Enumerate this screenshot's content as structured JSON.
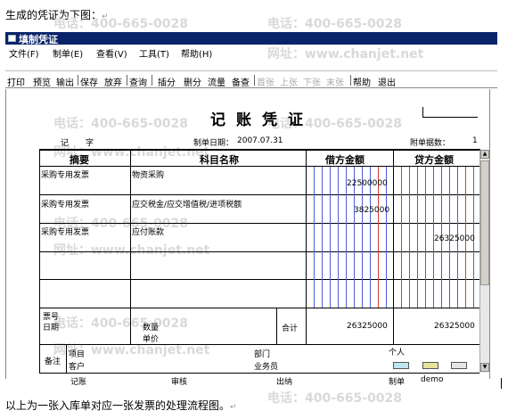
{
  "intro_text": "生成的凭证为下图：",
  "return_mark": "↵",
  "window": {
    "title": "填制凭证"
  },
  "watermark": {
    "phone": "电话：400-665-0028",
    "site": "网址：www.chanjet.net"
  },
  "menu": [
    "文件(F)",
    "制单(E)",
    "查看(V)",
    "工具(T)",
    "帮助(H)"
  ],
  "toolbar": {
    "print": "打印",
    "preview": "预览",
    "export": "输出",
    "save": "保存",
    "discard": "放弃",
    "query": "查询",
    "insert": "插分",
    "delete": "删分",
    "flow": "流量",
    "note": "备查",
    "first": "首张",
    "prev": "上张",
    "next": "下张",
    "last": "末张",
    "help": "帮助",
    "exit": "退出"
  },
  "voucher": {
    "title": "记账凭证",
    "type_label": "记",
    "number_label": "字",
    "date_label": "制单日期：",
    "date": "2007.07.31",
    "attach_label": "附单据数：",
    "attach_count": "1",
    "columns": {
      "summary": "摘要",
      "account": "科目名称",
      "debit": "借方金额",
      "credit": "贷方金额"
    },
    "rows": [
      {
        "summary": "采购专用发票",
        "account": "物资采购",
        "debit": "22500000",
        "credit": ""
      },
      {
        "summary": "",
        "account": "",
        "debit": "3825000",
        "credit": ""
      },
      {
        "summary": "采购专用发票",
        "account": "应交税金/应交增值税/进项税额",
        "debit": "",
        "credit": ""
      },
      {
        "summary": "采购专用发票",
        "account": "应付账款",
        "debit": "",
        "credit": "26325000"
      }
    ],
    "ticket_no_label": "票号",
    "date2_label": "日期",
    "quantity_label": "数量",
    "unit_price_label": "单价",
    "total_label": "合计",
    "total_debit": "26325000",
    "total_credit": "26325000",
    "remark_label": "备注",
    "project_label": "项目",
    "dept_label": "部门",
    "person_label": "个人",
    "customer_label": "客户",
    "salesman_label": "业务员",
    "bookkeeper_label": "记账",
    "reviewer_label": "审核",
    "cashier_label": "出纳",
    "maker_label": "制单",
    "maker": "demo"
  },
  "outro_text": "以上为一张入库单对应一张发票的处理流程图。"
}
